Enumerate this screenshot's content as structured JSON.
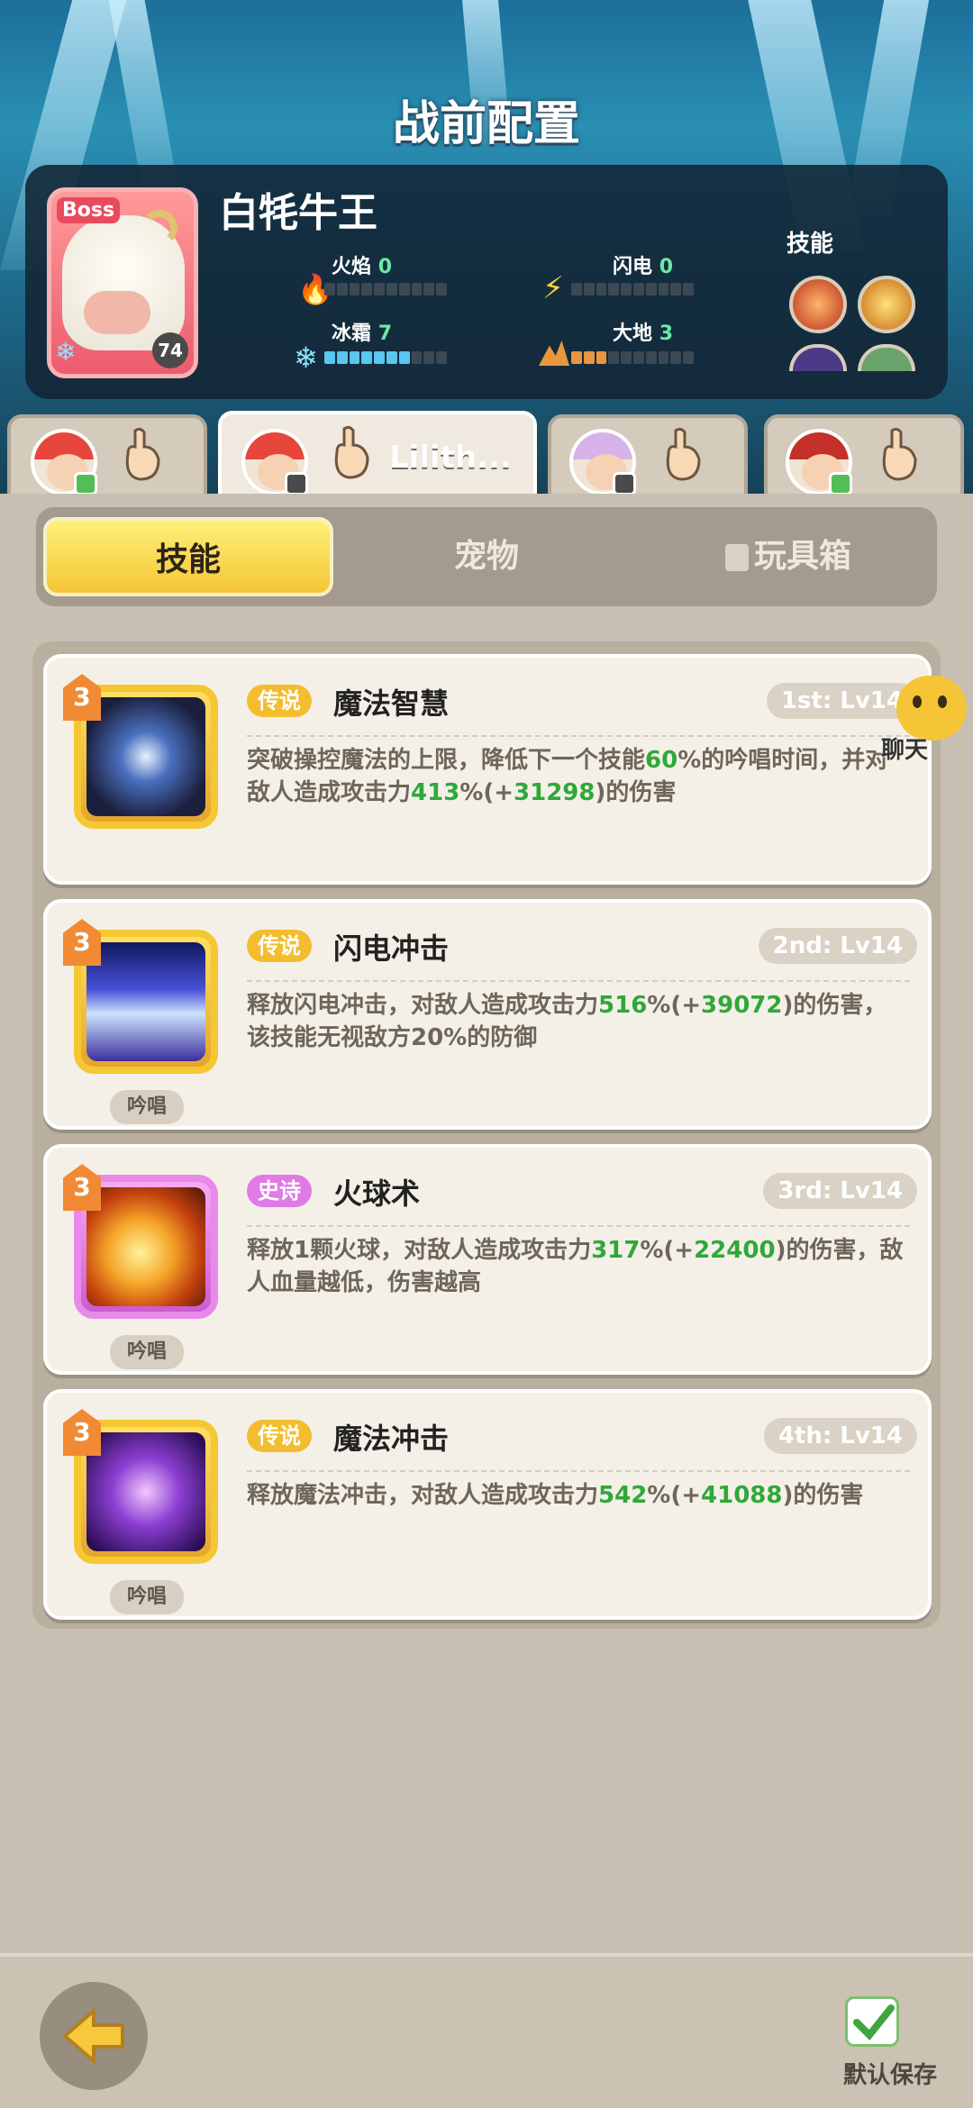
{
  "title": "战前配置",
  "boss": {
    "badge": "Boss",
    "name": "白牦牛王",
    "level": "74",
    "stats": {
      "fire_label": "火焰",
      "fire_value": "0",
      "fire_level": 0,
      "lightning_label": "闪电",
      "lightning_value": "0",
      "lightning_level": 0,
      "frost_label": "冰霜",
      "frost_value": "7",
      "frost_level": 7,
      "earth_label": "大地",
      "earth_value": "3",
      "earth_level": 3
    },
    "skills_label": "技能"
  },
  "hero_tabs": [
    {
      "name": "",
      "active": false
    },
    {
      "name": "Lilith...",
      "active": true
    },
    {
      "name": "",
      "active": false
    },
    {
      "name": "",
      "active": false
    }
  ],
  "segments": {
    "skills": "技能",
    "pets": "宠物",
    "toybox": "玩具箱"
  },
  "skills": [
    {
      "rank": "3",
      "rarity": "传说",
      "name": "魔法智慧",
      "order": "1st: Lv14",
      "desc_parts": [
        "突破操控魔法的上限，降低下一个技能",
        "60",
        "%的吟唱时间，并对敌人造成攻击力",
        "413",
        "%(+",
        "31298",
        ")的伤害"
      ],
      "cast": ""
    },
    {
      "rank": "3",
      "rarity": "传说",
      "name": "闪电冲击",
      "order": "2nd: Lv14",
      "desc_parts": [
        "释放闪电冲击，对敌人造成攻击力",
        "516",
        "%(+",
        "39072",
        ")的伤害，该技能无视敌方20%的防御"
      ],
      "cast": "吟唱"
    },
    {
      "rank": "3",
      "rarity": "史诗",
      "name": "火球术",
      "order": "3rd: Lv14",
      "desc_parts": [
        "释放1颗火球，对敌人造成攻击力",
        "317",
        "%(+",
        "22400",
        ")的伤害，敌人血量越低，伤害越高"
      ],
      "cast": "吟唱"
    },
    {
      "rank": "3",
      "rarity": "传说",
      "name": "魔法冲击",
      "order": "4th: Lv14",
      "desc_parts": [
        "释放魔法冲击，对敌人造成攻击力",
        "542",
        "%(+",
        "41088",
        ")的伤害"
      ],
      "cast": "吟唱"
    }
  ],
  "chat_label": "聊天",
  "footer": {
    "save_label": "默认保存"
  },
  "colors": {
    "legend": "#f3bd2f",
    "epic": "#e07ae4",
    "highlight": "#2fa83a"
  }
}
